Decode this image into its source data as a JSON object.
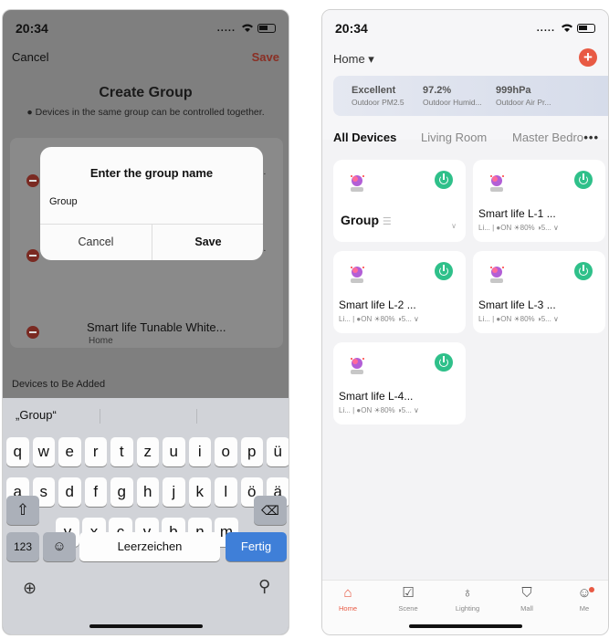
{
  "left": {
    "status": {
      "time": "20:34",
      "signal": "....."
    },
    "nav": {
      "cancel": "Cancel",
      "save": "Save"
    },
    "title": "Create Group",
    "info": "Devices in the same group can be controlled together.",
    "device_rows": [
      {
        "name": "Smart life Tunable White...",
        "sub": "Home"
      }
    ],
    "to_add_label": "Devices to Be Added",
    "dialog": {
      "title": "Enter the group name",
      "value": "Group",
      "cancel": "Cancel",
      "save": "Save"
    },
    "keyboard": {
      "suggestion": "„Group“",
      "row1": [
        "q",
        "w",
        "e",
        "r",
        "t",
        "z",
        "u",
        "i",
        "o",
        "p",
        "ü"
      ],
      "row2": [
        "a",
        "s",
        "d",
        "f",
        "g",
        "h",
        "j",
        "k",
        "l",
        "ö",
        "ä"
      ],
      "row3": [
        "y",
        "x",
        "c",
        "v",
        "b",
        "n",
        "m"
      ],
      "numbers": "123",
      "space": "Leerzeichen",
      "done": "Fertig"
    }
  },
  "right": {
    "status": {
      "time": "20:34",
      "signal": "....."
    },
    "home_label": "Home ▾",
    "weather": [
      {
        "value": "Excellent",
        "label": "Outdoor PM2.5"
      },
      {
        "value": "97.2%",
        "label": "Outdoor Humid..."
      },
      {
        "value": "999hPa",
        "label": "Outdoor Air Pr..."
      }
    ],
    "tabs": [
      "All Devices",
      "Living Room",
      "Master Bedro"
    ],
    "tabs_more": "•••",
    "group_card": {
      "name": "Group"
    },
    "devices": [
      {
        "name": "Smart life L-1 ...",
        "status": "Li... | ●ON ☀80% ◑5... ∨"
      },
      {
        "name": "Smart life L-2 ...",
        "status": "Li... | ●ON ☀80% ◑5... ∨"
      },
      {
        "name": "Smart life L-3 ...",
        "status": "Li... | ●ON ☀80% ◑5... ∨"
      },
      {
        "name": "Smart life  L-4...",
        "status": "Li... | ●ON ☀80% ◑5... ∨"
      }
    ],
    "nav": [
      {
        "label": "Home",
        "icon": "home-icon"
      },
      {
        "label": "Scene",
        "icon": "scene-icon"
      },
      {
        "label": "Lighting",
        "icon": "lighting-icon"
      },
      {
        "label": "Mall",
        "icon": "mall-icon"
      },
      {
        "label": "Me",
        "icon": "me-icon"
      }
    ],
    "accent": "#e85a44",
    "power_color": "#2fc08a"
  }
}
